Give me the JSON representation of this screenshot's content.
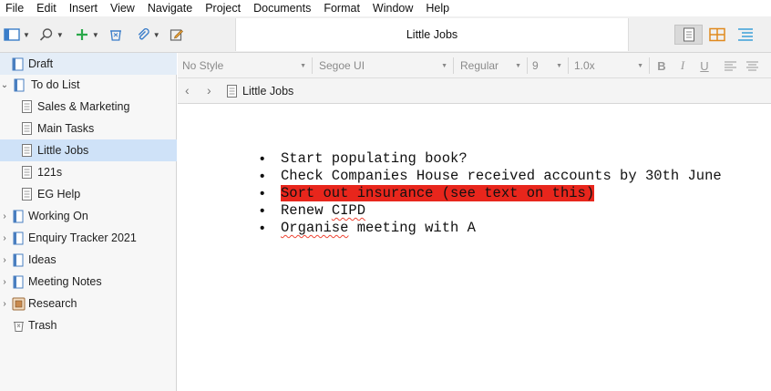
{
  "menu": [
    "File",
    "Edit",
    "Insert",
    "View",
    "Navigate",
    "Project",
    "Documents",
    "Format",
    "Window",
    "Help"
  ],
  "toolbar": {
    "document_title": "Little Jobs"
  },
  "binder": {
    "items": [
      {
        "label": "Draft",
        "icon": "draft-icon"
      },
      {
        "label": "To do List",
        "icon": "folder-doc-icon"
      },
      {
        "label": "Sales & Marketing",
        "icon": "document-icon"
      },
      {
        "label": "Main Tasks",
        "icon": "document-icon"
      },
      {
        "label": "Little Jobs",
        "icon": "document-icon"
      },
      {
        "label": "121s",
        "icon": "document-icon"
      },
      {
        "label": "EG Help",
        "icon": "document-icon"
      },
      {
        "label": "Working On",
        "icon": "folder-doc-icon"
      },
      {
        "label": "Enquiry Tracker 2021",
        "icon": "folder-doc-icon"
      },
      {
        "label": "Ideas",
        "icon": "folder-doc-icon"
      },
      {
        "label": "Meeting Notes",
        "icon": "folder-doc-icon"
      },
      {
        "label": "Research",
        "icon": "research-icon"
      },
      {
        "label": "Trash",
        "icon": "trash-icon"
      }
    ]
  },
  "format": {
    "style": "No Style",
    "font": "Segoe UI",
    "weight": "Regular",
    "size": "9",
    "line_spacing": "1.0x",
    "bold": "B",
    "italic": "I",
    "underline": "U"
  },
  "nav": {
    "title": "Little Jobs"
  },
  "editor": {
    "lines": [
      "Start populating book?",
      "Check Companies House received accounts by 30th June",
      "Sort out insurance (see text on this)",
      "Renew ",
      "CIPD",
      "Organise",
      " meeting with A"
    ],
    "bullet": "•",
    "highlight_color": "#e8261c"
  }
}
